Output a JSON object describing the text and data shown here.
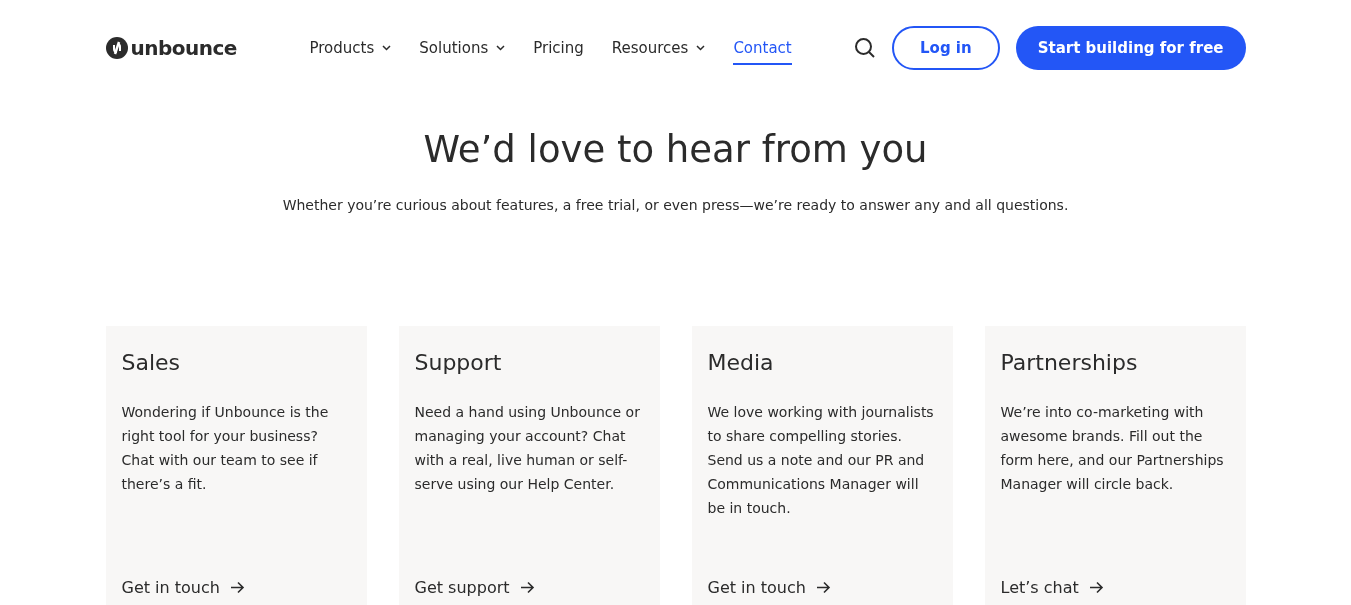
{
  "header": {
    "logo": "unbounce",
    "nav": [
      {
        "label": "Products",
        "has_menu": true,
        "selected": false
      },
      {
        "label": "Solutions",
        "has_menu": true,
        "selected": false
      },
      {
        "label": "Pricing",
        "has_menu": false,
        "selected": false
      },
      {
        "label": "Resources",
        "has_menu": true,
        "selected": false
      },
      {
        "label": "Contact",
        "has_menu": false,
        "selected": true
      }
    ],
    "login": "Log in",
    "cta": "Start building for free"
  },
  "hero": {
    "title": "We’d love to hear from you",
    "subtitle": "Whether you’re curious about features, a free trial, or even press—we’re ready to answer any and all questions."
  },
  "cards": [
    {
      "title": "Sales",
      "text": "Wondering if Unbounce is the right tool for your business? Chat with our team to see if there’s a fit.",
      "link": "Get in touch"
    },
    {
      "title": "Support",
      "text": "Need a hand using Unbounce or managing your account? Chat with a real, live human or self-serve using our Help Center.",
      "link": "Get support"
    },
    {
      "title": "Media",
      "text": "We love working with journalists to share compelling stories. Send us a note and our PR and Communications Manager will be in touch.",
      "link": "Get in touch"
    },
    {
      "title": "Partnerships",
      "text": "We’re into co-marketing with awesome brands. Fill out the form here, and our Partnerships Manager will circle back.",
      "link": "Let’s chat"
    }
  ]
}
